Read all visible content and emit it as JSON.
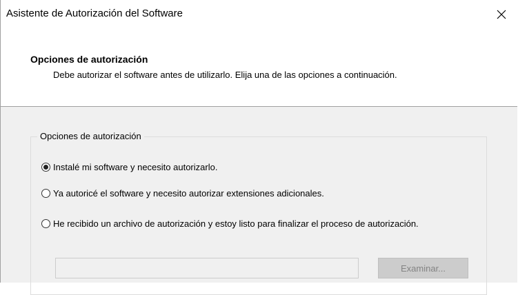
{
  "window": {
    "title": "Asistente de Autorización del Software"
  },
  "header": {
    "title": "Opciones de autorización",
    "description": "Debe autorizar el software antes de utilizarlo. Elija una de las opciones a continuación."
  },
  "options_group": {
    "legend": "Opciones de autorización",
    "options": [
      {
        "label": "Instalé mi software y necesito autorizarlo.",
        "selected": true
      },
      {
        "label": "Ya autoricé el software y necesito autorizar extensiones adicionales.",
        "selected": false
      },
      {
        "label": "He recibido un archivo de autorización y estoy listo para finalizar el proceso de autorización.",
        "selected": false
      }
    ],
    "file_path_value": "",
    "browse_label": "Examinar..."
  },
  "icons": {
    "close": "close-icon"
  }
}
